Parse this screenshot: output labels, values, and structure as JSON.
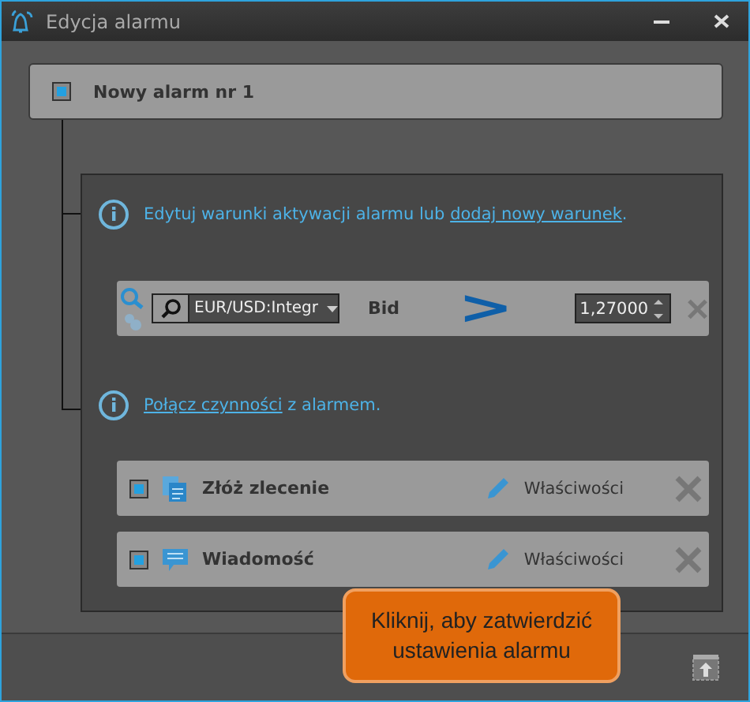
{
  "window": {
    "title": "Edycja alarmu"
  },
  "alarm": {
    "name": "Nowy alarm nr 1",
    "checked": true
  },
  "conditions_info": {
    "text": "Edytuj warunki aktywacji alarmu lub ",
    "link": "dodaj nowy warunek",
    "suffix": "."
  },
  "condition": {
    "instrument": "EUR/USD:Integr",
    "price_type": "Bid",
    "operator": ">",
    "value": "1,27000"
  },
  "actions_info": {
    "link": "Połącz czynności",
    "text": " z alarmem."
  },
  "actions": [
    {
      "kind": "order",
      "name": "Złóż zlecenie",
      "checked": true,
      "properties": "Właściwości"
    },
    {
      "kind": "message",
      "name": "Wiadomość",
      "checked": true,
      "properties": "Właściwości"
    }
  ],
  "callout": {
    "text": "Kliknij, aby zatwierdzić ustawienia alarmu"
  }
}
